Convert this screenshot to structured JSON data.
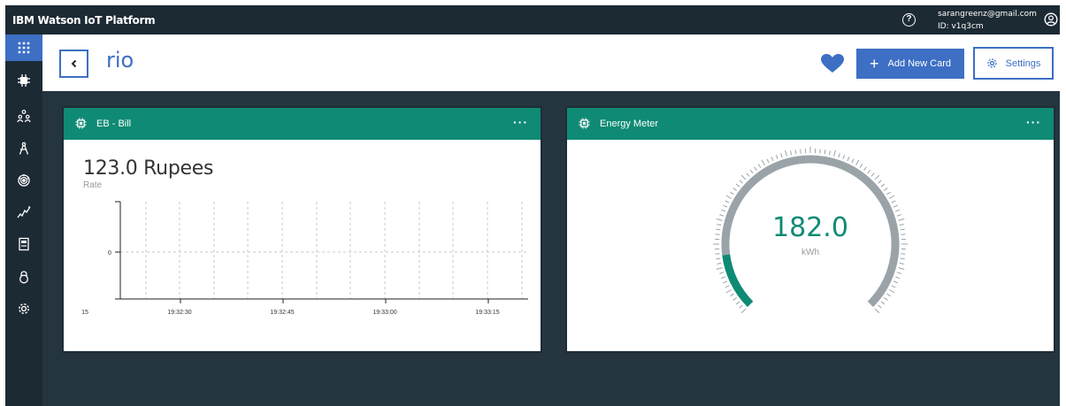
{
  "topbar": {
    "title": "IBM Watson IoT Platform",
    "help_icon": "question-icon",
    "help_glyph": "?",
    "user_email": "sarangreenz@gmail.com",
    "user_id": "ID: v1q3cm",
    "user_icon": "user-icon"
  },
  "sidebar": {
    "items": [
      {
        "icon": "app-grid-icon",
        "active": true
      },
      {
        "icon": "chip-icon",
        "active": false
      },
      {
        "icon": "members-icon",
        "active": false
      },
      {
        "icon": "apps-icon",
        "active": false
      },
      {
        "icon": "rules-icon",
        "active": false
      },
      {
        "icon": "usage-icon",
        "active": false
      },
      {
        "icon": "extensions-icon",
        "active": false
      },
      {
        "icon": "security-icon",
        "active": false
      },
      {
        "icon": "settings-icon",
        "active": false
      }
    ]
  },
  "header": {
    "title": "rio",
    "add_card_label": "Add New Card",
    "settings_label": "Settings"
  },
  "cards": {
    "bill": {
      "title": "EB - Bill",
      "menu": "···",
      "value_text": "123.0 Rupees",
      "label": "Rate"
    },
    "energy": {
      "title": "Energy Meter",
      "menu": "···",
      "value": "182.0",
      "unit": "kWh"
    }
  },
  "colors": {
    "accent": "#3d6fc4",
    "card_header": "#0f8a74",
    "background": "#253540",
    "topbar": "#1c2a34"
  },
  "chart_data": {
    "type": "line",
    "y_tick_labels": [
      "0"
    ],
    "x_tick_labels": [
      "15",
      "19:32:30",
      "19:32:45",
      "19:33:00",
      "19:33:15"
    ],
    "series": [],
    "grid": true
  },
  "gauge_data": {
    "value": 182.0,
    "fill_fraction": 0.14
  }
}
